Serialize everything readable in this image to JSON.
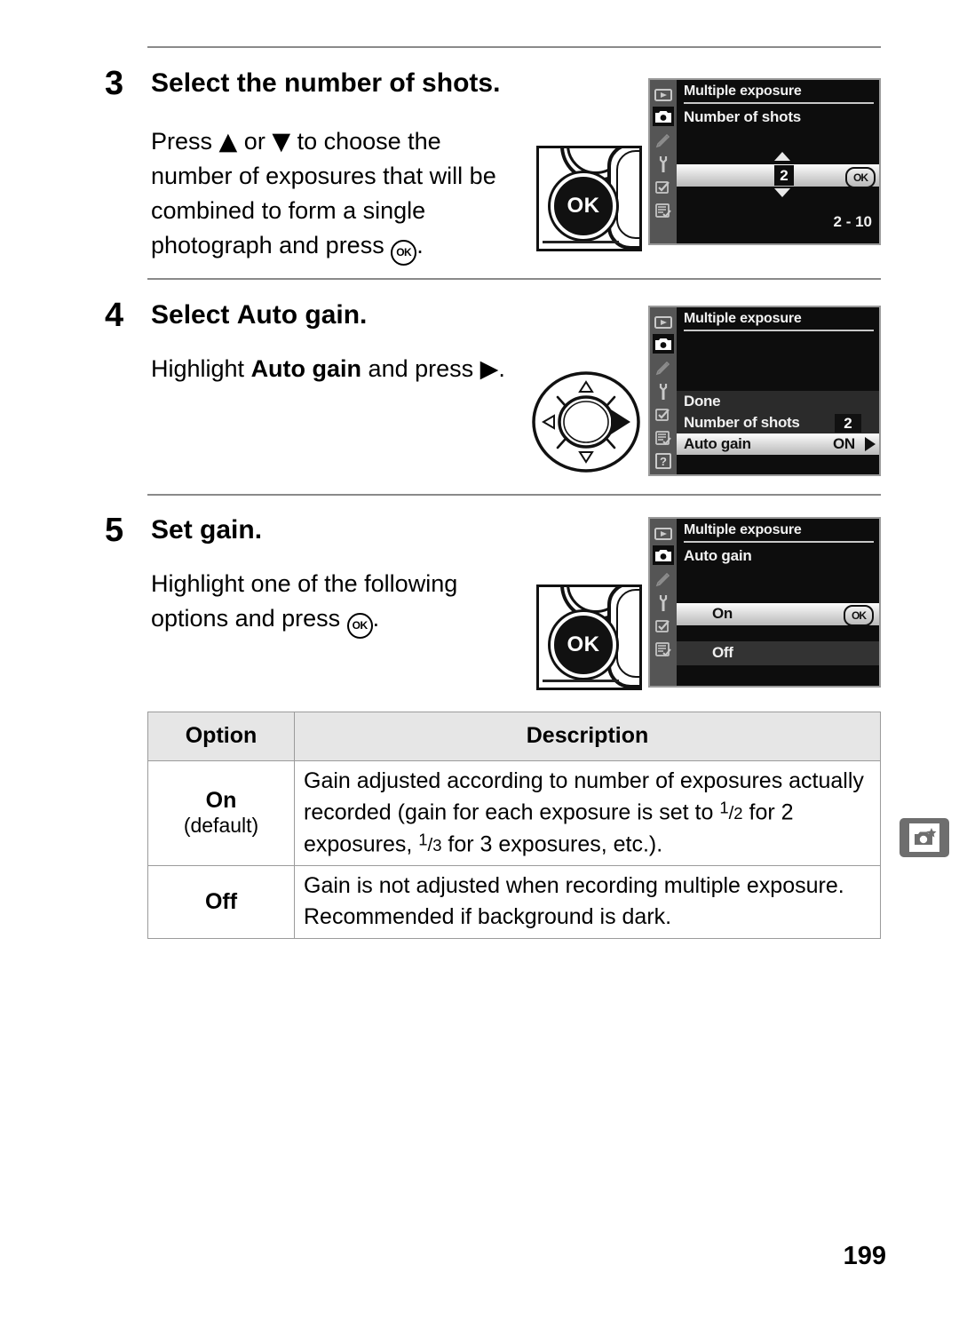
{
  "page": {
    "number": "199"
  },
  "steps": [
    {
      "number": "3",
      "title": "Select the number of shots.",
      "body_before": "Press ",
      "body_arrow_up": "▲",
      "body_mid": " or ",
      "body_arrow_dn": "▼",
      "body_after": " to choose the number of exposures that will be combined to form a single photograph and press ",
      "body_ok": "OK",
      "body_end": ".",
      "control_art": "ok-button"
    },
    {
      "number": "4",
      "title_plain": "Select ",
      "title_bold": "Auto gain",
      "title_end": ".",
      "body_before": "Highlight ",
      "body_bold": "Auto gain",
      "body_after": " and press ",
      "body_arrow_right": "▶",
      "body_end": ".",
      "control_art": "multi-selector"
    },
    {
      "number": "5",
      "title": "Set gain.",
      "body_before": "Highlight one of the following options and press ",
      "body_ok": "OK",
      "body_end": ".",
      "control_art": "ok-button"
    }
  ],
  "lcd_screens": [
    {
      "id": "number-of-shots",
      "title": "Multiple exposure",
      "subtitle": "Number of shots",
      "value": "2",
      "ok_badge": "OK",
      "range": "2 - 10",
      "sidebar_icons": [
        "playback-icon",
        "camera-icon",
        "pencil-icon",
        "wrench-icon",
        "pencil-check-icon",
        "list-check-icon"
      ],
      "selected_sidebar_index": 1
    },
    {
      "id": "multiple-exposure-menu",
      "title": "Multiple exposure",
      "rows": [
        {
          "label": "Done",
          "value": "",
          "state": "dark"
        },
        {
          "label": "Number of shots",
          "value": "2",
          "state": "dark"
        },
        {
          "label": "Auto gain",
          "value": "ON",
          "state": "highlighted"
        }
      ],
      "sidebar_icons": [
        "playback-icon",
        "camera-icon",
        "pencil-icon",
        "wrench-icon",
        "pencil-check-icon",
        "list-check-icon",
        "help-icon"
      ],
      "selected_sidebar_index": 1
    },
    {
      "id": "auto-gain-options",
      "title": "Multiple exposure",
      "subtitle": "Auto gain",
      "options": [
        {
          "label": "On",
          "state": "highlighted",
          "ok_badge": "OK"
        },
        {
          "label": "Off",
          "state": "dark",
          "ok_badge": ""
        }
      ],
      "sidebar_icons": [
        "playback-icon",
        "camera-icon",
        "pencil-icon",
        "wrench-icon",
        "pencil-check-icon",
        "list-check-icon"
      ],
      "selected_sidebar_index": 1
    }
  ],
  "table": {
    "headers": [
      "Option",
      "Description"
    ],
    "rows": [
      {
        "option": "On",
        "option_note": "(default)",
        "desc_part1": "Gain adjusted according to number of exposures actually recorded (gain for each exposure is set to ",
        "desc_frac1_num": "1",
        "desc_frac1_den": "2",
        "desc_part2": " for 2 exposures, ",
        "desc_frac2_num": "1",
        "desc_frac2_den": "3",
        "desc_part3": " for 3 exposures, etc.)."
      },
      {
        "option": "Off",
        "option_note": "",
        "desc_part1": "Gain is not adjusted when recording multiple exposure. Recommended if background is dark.",
        "desc_frac1_num": "",
        "desc_frac1_den": "",
        "desc_part2": "",
        "desc_frac2_num": "",
        "desc_frac2_den": "",
        "desc_part3": ""
      }
    ]
  },
  "side_tab": {
    "icon": "camera-star-icon"
  }
}
